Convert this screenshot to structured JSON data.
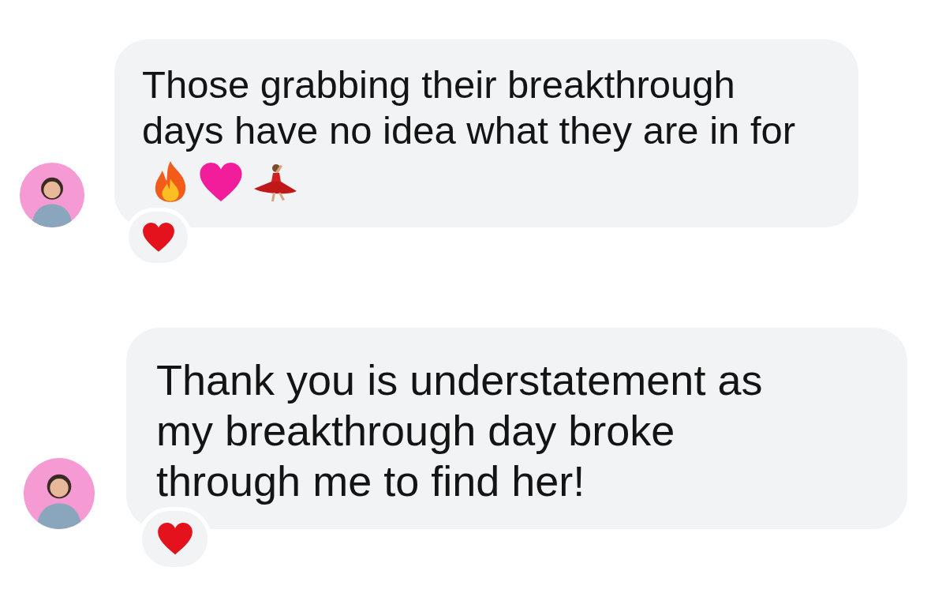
{
  "messages": [
    {
      "text": "Those grabbing their breakthrough days have no idea what they are in for",
      "trailing_icons": [
        {
          "kind": "fire"
        },
        {
          "kind": "pink-heart"
        },
        {
          "kind": "dancer"
        }
      ],
      "reaction": {
        "kind": "heart"
      }
    },
    {
      "text": "Thank you is understatement as my breakthrough day broke through me to find her!",
      "reaction": {
        "kind": "heart"
      }
    }
  ]
}
